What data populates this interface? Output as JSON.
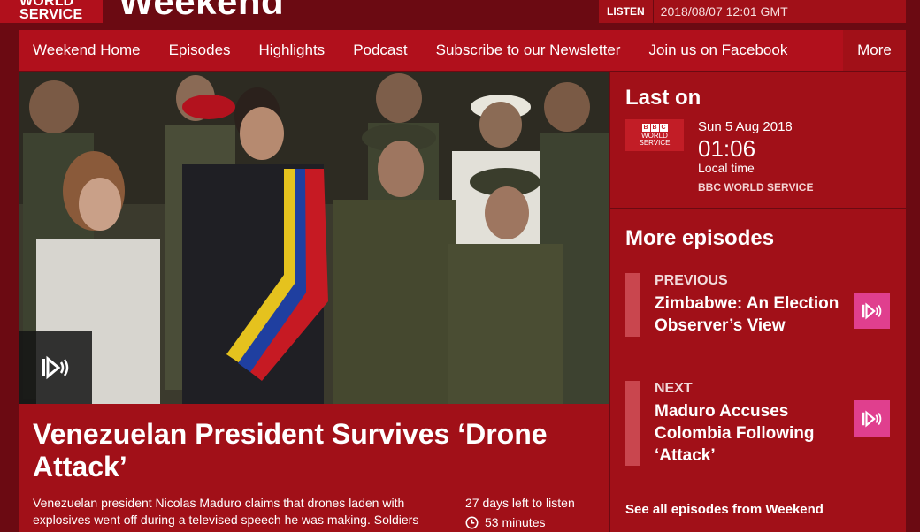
{
  "brand": {
    "network_name": "WORLD SERVICE",
    "programme_title": "Weekend"
  },
  "broadcast": {
    "listen_label": "LISTEN",
    "timestamp": "2018/08/07 12:01 GMT"
  },
  "nav": {
    "items": [
      {
        "label": "Weekend Home"
      },
      {
        "label": "Episodes"
      },
      {
        "label": "Highlights"
      },
      {
        "label": "Podcast"
      },
      {
        "label": "Subscribe to our Newsletter"
      },
      {
        "label": "Join us on Facebook"
      }
    ],
    "more_label": "More"
  },
  "episode": {
    "title": "Venezuelan President Survives ‘Drone Attack’",
    "description": "Venezuelan president Nicolas Maduro claims that drones laden with explosives went off during a televised speech he was making. Soldiers",
    "availability": "27 days left to listen",
    "duration": "53 minutes"
  },
  "last_on": {
    "heading": "Last on",
    "logo_lines": [
      "WORLD",
      "SERVICE"
    ],
    "date": "Sun 5 Aug 2018",
    "time": "01:06",
    "time_label": "Local time",
    "station": "BBC WORLD SERVICE"
  },
  "more_episodes": {
    "heading": "More episodes",
    "previous": {
      "label": "PREVIOUS",
      "title": "Zimbabwe: An Election Observer’s View"
    },
    "next": {
      "label": "NEXT",
      "title": "Maduro Accuses Colombia Following ‘Attack’"
    },
    "see_all": "See all episodes from Weekend"
  },
  "colors": {
    "background": "#6b0a12",
    "panel": "#a11018",
    "nav": "#b1101c",
    "play_accent": "#e03f8e"
  }
}
